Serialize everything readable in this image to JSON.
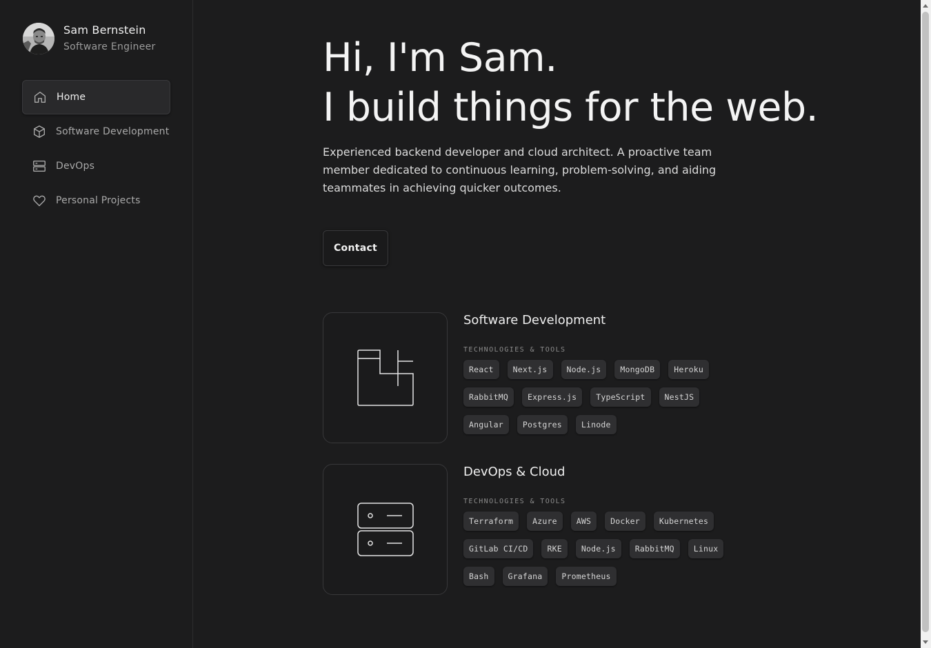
{
  "profile": {
    "name": "Sam Bernstein",
    "role": "Software Engineer"
  },
  "nav": {
    "items": [
      {
        "label": "Home",
        "icon": "home-icon",
        "active": true
      },
      {
        "label": "Software Development",
        "icon": "cube-icon",
        "active": false
      },
      {
        "label": "DevOps",
        "icon": "server-icon",
        "active": false
      },
      {
        "label": "Personal Projects",
        "icon": "heart-icon",
        "active": false
      }
    ]
  },
  "hero": {
    "line1": "Hi, I'm Sam.",
    "line2": "I build things for the web.",
    "description": "Experienced backend developer and cloud architect. A proactive team member dedicated to continuous learning, problem-solving, and aiding teammates in achieving quicker outcomes.",
    "contact_label": "Contact"
  },
  "sections": [
    {
      "title": "Software Development",
      "subtitle": "TECHNOLOGIES & TOOLS",
      "icon": "layout-icon",
      "tags": [
        "React",
        "Next.js",
        "Node.js",
        "MongoDB",
        "Heroku",
        "RabbitMQ",
        "Express.js",
        "TypeScript",
        "NestJS",
        "Angular",
        "Postgres",
        "Linode"
      ]
    },
    {
      "title": "DevOps & Cloud",
      "subtitle": "TECHNOLOGIES & TOOLS",
      "icon": "server-icon",
      "tags": [
        "Terraform",
        "Azure",
        "AWS",
        "Docker",
        "Kubernetes",
        "GitLab CI/CD",
        "RKE",
        "Node.js",
        "RabbitMQ",
        "Linux",
        "Bash",
        "Grafana",
        "Prometheus"
      ]
    }
  ],
  "colors": {
    "background": "#1c1c1d",
    "text": "#f4f4f4",
    "muted": "#a9a9a9",
    "tag_bg": "#2f2f31"
  }
}
